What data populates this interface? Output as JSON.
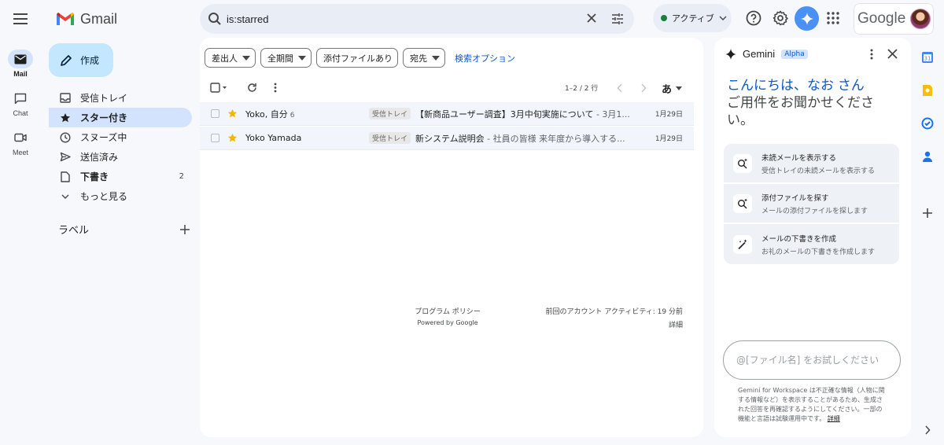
{
  "rail": {
    "items": [
      {
        "label": "Mail",
        "icon": "mail-icon"
      },
      {
        "label": "Chat",
        "icon": "chat-icon"
      },
      {
        "label": "Meet",
        "icon": "video-icon"
      }
    ]
  },
  "header": {
    "logo_text": "Gmail",
    "search_value": "is:starred",
    "status_label": "アクティブ",
    "status_color": "#188038",
    "google_wordmark": "Google"
  },
  "compose": {
    "label": "作成"
  },
  "nav": {
    "items": [
      {
        "label": "受信トレイ",
        "icon": "inbox-icon"
      },
      {
        "label": "スター付き",
        "icon": "star-icon",
        "active": true
      },
      {
        "label": "スヌーズ中",
        "icon": "clock-icon"
      },
      {
        "label": "送信済み",
        "icon": "send-icon"
      },
      {
        "label": "下書き",
        "icon": "draft-icon",
        "count": "2"
      },
      {
        "label": "もっと見る",
        "icon": "chevron-down-icon"
      }
    ],
    "labels_heading": "ラベル"
  },
  "filters": {
    "chips": [
      "差出人",
      "全期間",
      "添付ファイルあり",
      "宛先"
    ],
    "search_options": "検索オプション"
  },
  "toolbar": {
    "pagination": "1–2 / 2 行",
    "input_tool": "あ"
  },
  "emails": [
    {
      "sender": "Yoko, 自分",
      "count": "6",
      "tag": "受信トレイ",
      "subject": "【新商品ユーザー調査】3月中旬実施について",
      "snippet": " - 3月1...",
      "date": "1月29日",
      "starred": true
    },
    {
      "sender": "Yoko Yamada",
      "count": "",
      "tag": "受信トレイ",
      "subject": "新システム説明会",
      "snippet": " - 社員の皆様 来年度から導入する...",
      "date": "1月29日",
      "starred": true
    }
  ],
  "footer": {
    "policy": "プログラム ポリシー",
    "powered": "Powered by Google",
    "activity": "前回のアカウント アクティビティ: 19 分前",
    "details": "詳細"
  },
  "gemini": {
    "title": "Gemini",
    "badge": "Alpha",
    "hello": "こんにちは、なお さん",
    "ask": "ご用件をお聞かせください。",
    "suggestions": [
      {
        "title": "未読メールを表示する",
        "sub": "受信トレイの未読メールを表示する",
        "icon": "search-sparkle-icon"
      },
      {
        "title": "添付ファイルを探す",
        "sub": "メールの添付ファイルを探します",
        "icon": "search-sparkle-icon"
      },
      {
        "title": "メールの下書きを作成",
        "sub": "お礼のメールの下書きを作成します",
        "icon": "magic-pen-icon"
      }
    ],
    "input_placeholder": "@[ファイル名] をお試しください",
    "disclaimer": "Gemini for Workspace は不正確な情報（人物に関する情報など）を表示することがあるため、生成された回答を再確認するようにしてください。一部の機能と言語は試験運用中です。",
    "disclaimer_link": "詳細"
  },
  "colors": {
    "accent": "#0b57d0",
    "compose_bg": "#c2e7ff",
    "active_nav": "#d3e3fd",
    "star": "#f4b400",
    "gemini_button": "#4a90f5"
  }
}
